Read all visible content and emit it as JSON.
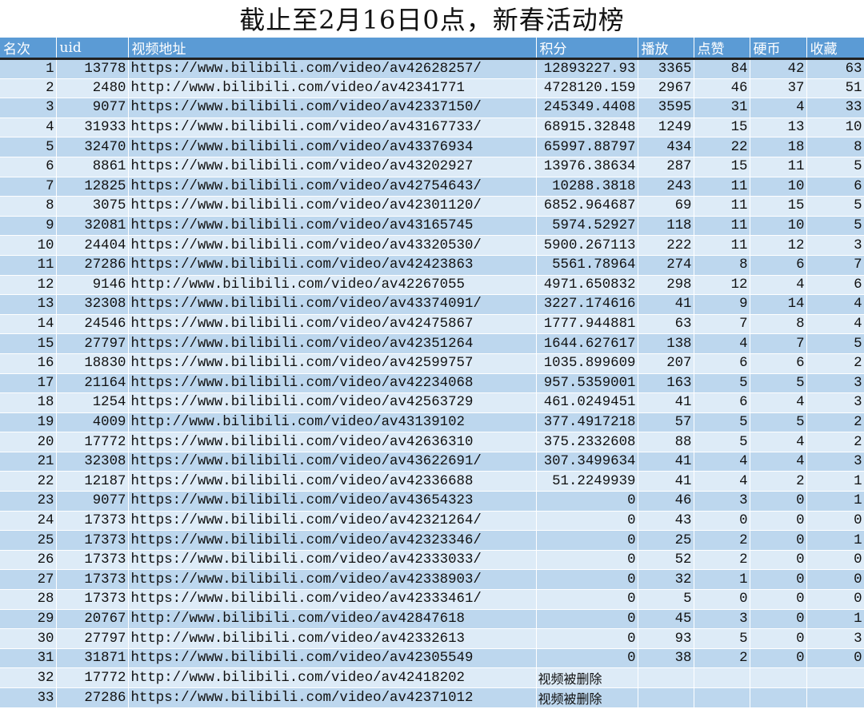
{
  "title": "截止至2月16日0点，新春活动榜",
  "columns": [
    "名次",
    "uid",
    "视频地址",
    "积分",
    "播放",
    "点赞",
    "硬币",
    "收藏"
  ],
  "colors": {
    "header_bg": "#5b9bd5",
    "row_odd": "#bdd7ee",
    "row_even": "#ddebf7"
  },
  "rows": [
    [
      "1",
      "13778",
      "https://www.bilibili.com/video/av42628257/",
      "12893227.93",
      "3365",
      "84",
      "42",
      "63"
    ],
    [
      "2",
      "2480",
      "http://www.bilibili.com/video/av42341771",
      "4728120.159",
      "2967",
      "46",
      "37",
      "51"
    ],
    [
      "3",
      "9077",
      "https://www.bilibili.com/video/av42337150/",
      "245349.4408",
      "3595",
      "31",
      "4",
      "33"
    ],
    [
      "4",
      "31933",
      "https://www.bilibili.com/video/av43167733/",
      "68915.32848",
      "1249",
      "15",
      "13",
      "10"
    ],
    [
      "5",
      "32470",
      "https://www.bilibili.com/video/av43376934",
      "65997.88797",
      "434",
      "22",
      "18",
      "8"
    ],
    [
      "6",
      "8861",
      "https://www.bilibili.com/video/av43202927",
      "13976.38634",
      "287",
      "15",
      "11",
      "5"
    ],
    [
      "7",
      "12825",
      "https://www.bilibili.com/video/av42754643/",
      "10288.3818",
      "243",
      "11",
      "10",
      "6"
    ],
    [
      "8",
      "3075",
      "https://www.bilibili.com/video/av42301120/",
      "6852.964687",
      "69",
      "11",
      "15",
      "5"
    ],
    [
      "9",
      "32081",
      "https://www.bilibili.com/video/av43165745",
      "5974.52927",
      "118",
      "11",
      "10",
      "5"
    ],
    [
      "10",
      "24404",
      "https://www.bilibili.com/video/av43320530/",
      "5900.267113",
      "222",
      "11",
      "12",
      "3"
    ],
    [
      "11",
      "27286",
      "https://www.bilibili.com/video/av42423863",
      "5561.78964",
      "274",
      "8",
      "6",
      "7"
    ],
    [
      "12",
      "9146",
      "http://www.bilibili.com/video/av42267055",
      "4971.650832",
      "298",
      "12",
      "4",
      "6"
    ],
    [
      "13",
      "32308",
      "https://www.bilibili.com/video/av43374091/",
      "3227.174616",
      "41",
      "9",
      "14",
      "4"
    ],
    [
      "14",
      "24546",
      "https://www.bilibili.com/video/av42475867",
      "1777.944881",
      "63",
      "7",
      "8",
      "4"
    ],
    [
      "15",
      "27797",
      "https://www.bilibili.com/video/av42351264",
      "1644.627617",
      "138",
      "4",
      "7",
      "5"
    ],
    [
      "16",
      "18830",
      "https://www.bilibili.com/video/av42599757",
      "1035.899609",
      "207",
      "6",
      "6",
      "2"
    ],
    [
      "17",
      "21164",
      "https://www.bilibili.com/video/av42234068",
      "957.5359001",
      "163",
      "5",
      "5",
      "3"
    ],
    [
      "18",
      "1254",
      "https://www.bilibili.com/video/av42563729",
      "461.0249451",
      "41",
      "6",
      "4",
      "3"
    ],
    [
      "19",
      "4009",
      "http://www.bilibili.com/video/av43139102",
      "377.4917218",
      "57",
      "5",
      "5",
      "2"
    ],
    [
      "20",
      "17772",
      "https://www.bilibili.com/video/av42636310",
      "375.2332608",
      "88",
      "5",
      "4",
      "2"
    ],
    [
      "21",
      "32308",
      "https://www.bilibili.com/video/av43622691/",
      "307.3499634",
      "41",
      "4",
      "4",
      "3"
    ],
    [
      "22",
      "12187",
      "https://www.bilibili.com/video/av42336688",
      "51.2249939",
      "41",
      "4",
      "2",
      "1"
    ],
    [
      "23",
      "9077",
      "https://www.bilibili.com/video/av43654323",
      "0",
      "46",
      "3",
      "0",
      "1"
    ],
    [
      "24",
      "17373",
      "https://www.bilibili.com/video/av42321264/",
      "0",
      "43",
      "0",
      "0",
      "0"
    ],
    [
      "25",
      "17373",
      "https://www.bilibili.com/video/av42323346/",
      "0",
      "25",
      "2",
      "0",
      "1"
    ],
    [
      "26",
      "17373",
      "https://www.bilibili.com/video/av42333033/",
      "0",
      "52",
      "2",
      "0",
      "0"
    ],
    [
      "27",
      "17373",
      "https://www.bilibili.com/video/av42338903/",
      "0",
      "32",
      "1",
      "0",
      "0"
    ],
    [
      "28",
      "17373",
      "https://www.bilibili.com/video/av42333461/",
      "0",
      "5",
      "0",
      "0",
      "0"
    ],
    [
      "29",
      "20767",
      "http://www.bilibili.com/video/av42847618",
      "0",
      "45",
      "3",
      "0",
      "1"
    ],
    [
      "30",
      "27797",
      "http://www.bilibili.com/video/av42332613",
      "0",
      "93",
      "5",
      "0",
      "3"
    ],
    [
      "31",
      "31871",
      "https://www.bilibili.com/video/av42305549",
      "0",
      "38",
      "2",
      "0",
      "0"
    ],
    [
      "32",
      "17772",
      "http://www.bilibili.com/video/av42418202",
      "视频被删除",
      "",
      "",
      "",
      ""
    ],
    [
      "33",
      "27286",
      "https://www.bilibili.com/video/av42371012",
      "视频被删除",
      "",
      "",
      "",
      ""
    ]
  ]
}
